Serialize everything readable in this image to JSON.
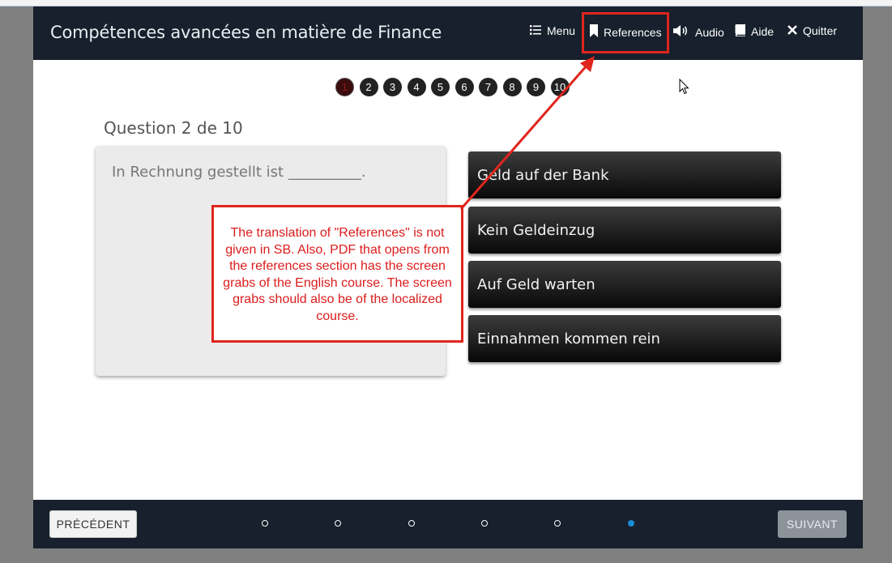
{
  "header": {
    "title": "Compétences avancées en matière de Finance",
    "nav": {
      "menu": "Menu",
      "references": "References",
      "audio": "Audio",
      "aide": "Aide",
      "quitter": "Quitter"
    }
  },
  "pager": {
    "pages": [
      "1",
      "2",
      "3",
      "4",
      "5",
      "6",
      "7",
      "8",
      "9",
      "10"
    ],
    "current": 1
  },
  "question": {
    "number_label": "Question 2 de 10",
    "prompt": "In Rechnung gestellt ist __________."
  },
  "options": [
    "Geld auf der Bank",
    "Kein Geldeinzug",
    "Auf Geld warten",
    "Einnahmen kommen rein"
  ],
  "annotation": {
    "text": "The translation of \"References\" is not given in SB. Also, PDF that opens from the references section has the screen grabs of the English course. The screen grabs should also be of the localized course.",
    "color": "#e0251d"
  },
  "footer": {
    "prev_label": "PRÉCÉDENT",
    "next_label": "SUIVANT",
    "progress_dots": 6,
    "active_dot": 6
  },
  "colors": {
    "header_bg": "#17202c",
    "accent_dot": "#1a8cd8"
  }
}
